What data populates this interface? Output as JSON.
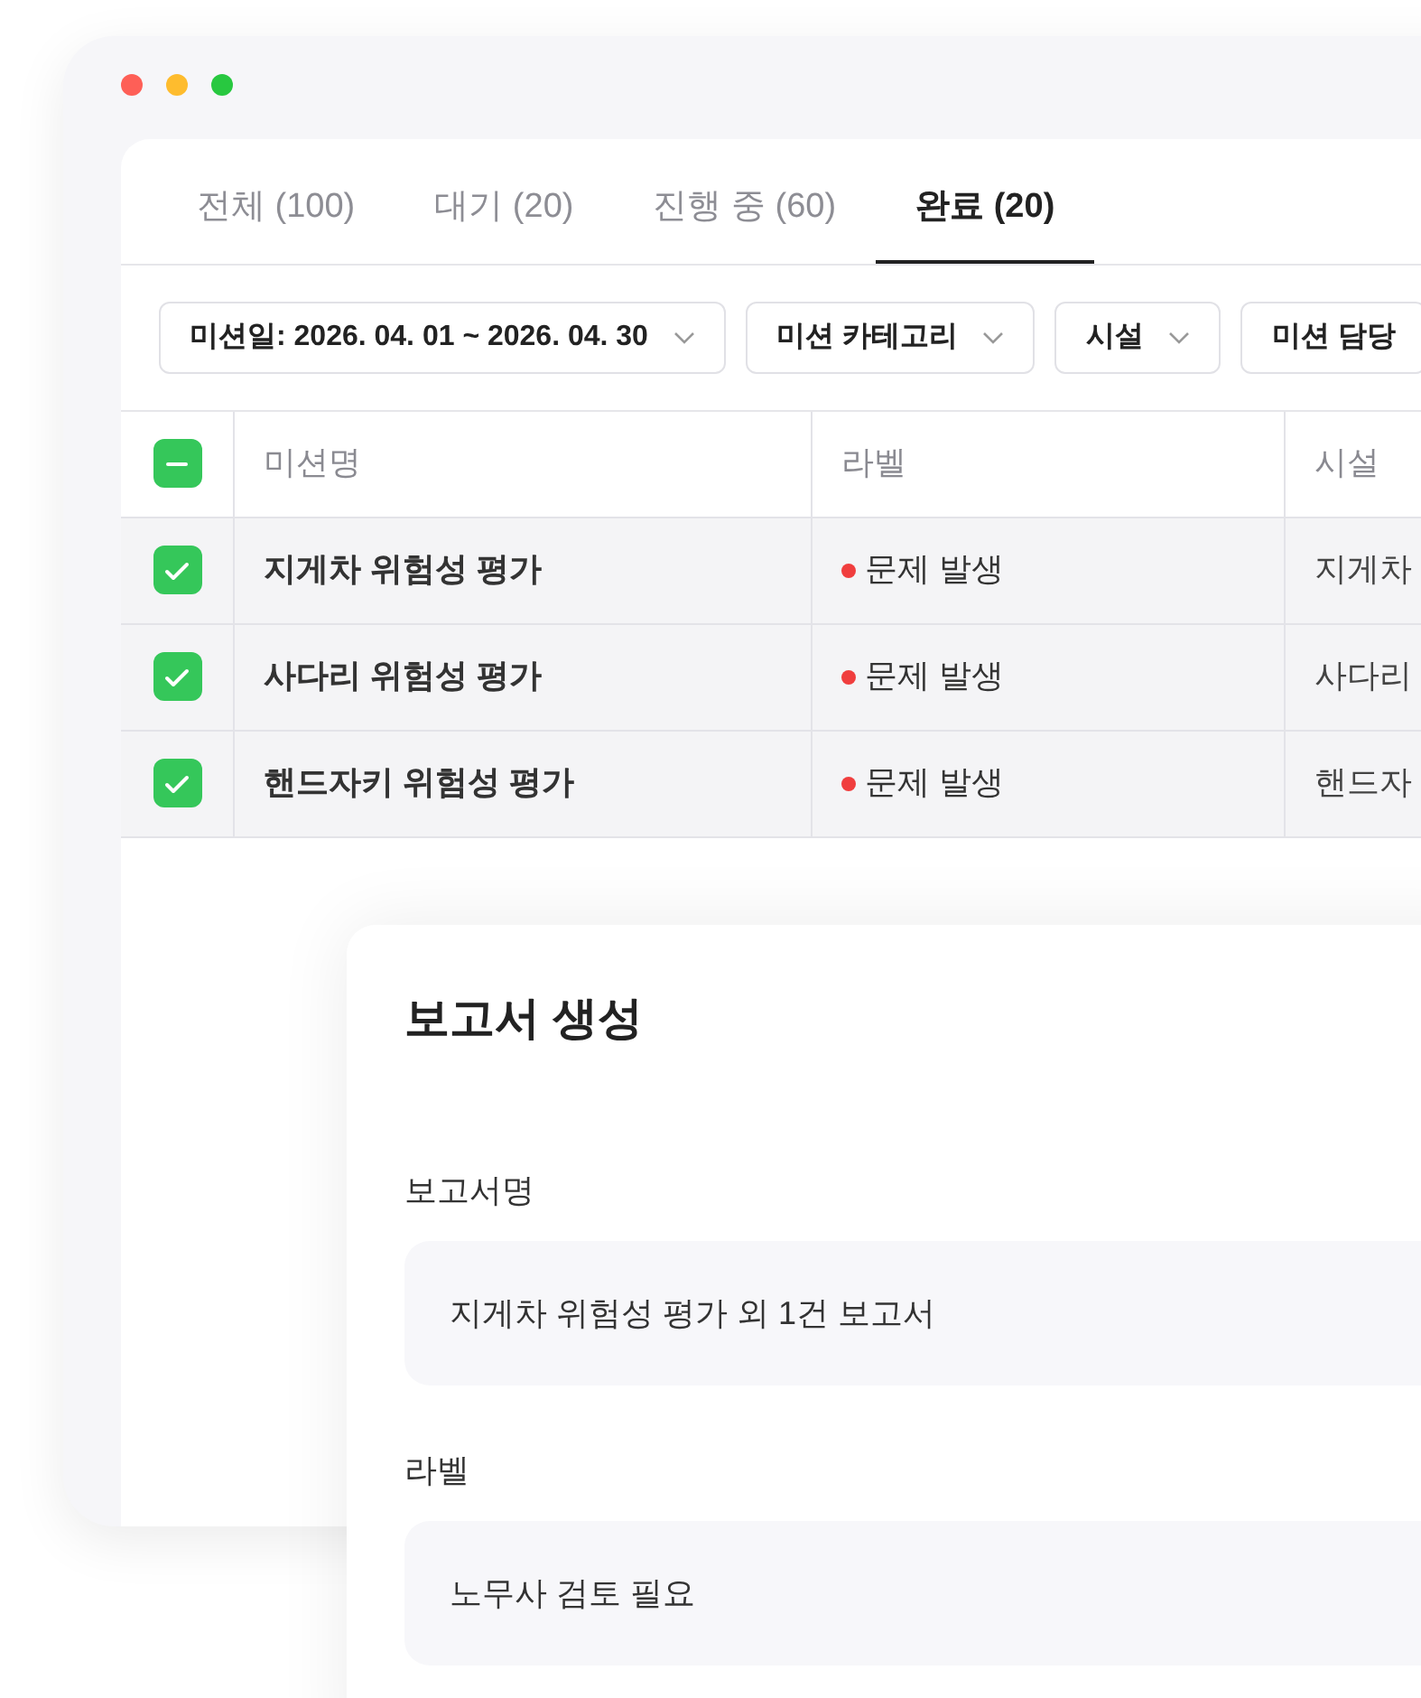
{
  "tabs": [
    {
      "label": "전체 (100)",
      "selected": false
    },
    {
      "label": "대기 (20)",
      "selected": false
    },
    {
      "label": "진행 중 (60)",
      "selected": false
    },
    {
      "label": "완료 (20)",
      "selected": true
    }
  ],
  "filters": [
    {
      "label": "미션일: 2026. 04. 01 ~ 2026. 04. 30",
      "has_caret": true
    },
    {
      "label": "미션 카테고리",
      "has_caret": true
    },
    {
      "label": "시설",
      "has_caret": true
    },
    {
      "label": "미션 담당",
      "has_caret": false
    }
  ],
  "table": {
    "header_checkbox": {
      "indeterminate": true
    },
    "columns": [
      "미션명",
      "라벨",
      "시설"
    ],
    "rows": [
      {
        "checked": true,
        "name": "지게차 위험성 평가",
        "label": "문제 발생",
        "color": "#f03e3e",
        "facility": "지게차"
      },
      {
        "checked": true,
        "name": "사다리 위험성 평가",
        "label": "문제 발생",
        "color": "#f03e3e",
        "facility": "사다리"
      },
      {
        "checked": true,
        "name": "핸드자키 위험성 평가",
        "label": "문제 발생",
        "color": "#f03e3e",
        "facility": "핸드자"
      }
    ]
  },
  "dialog": {
    "title": "보고서 생성",
    "fields": [
      {
        "label": "보고서명",
        "value": "지게차 위험성 평가 외 1건 보고서"
      },
      {
        "label": "라벨",
        "value": "노무사 검토 필요"
      }
    ]
  }
}
